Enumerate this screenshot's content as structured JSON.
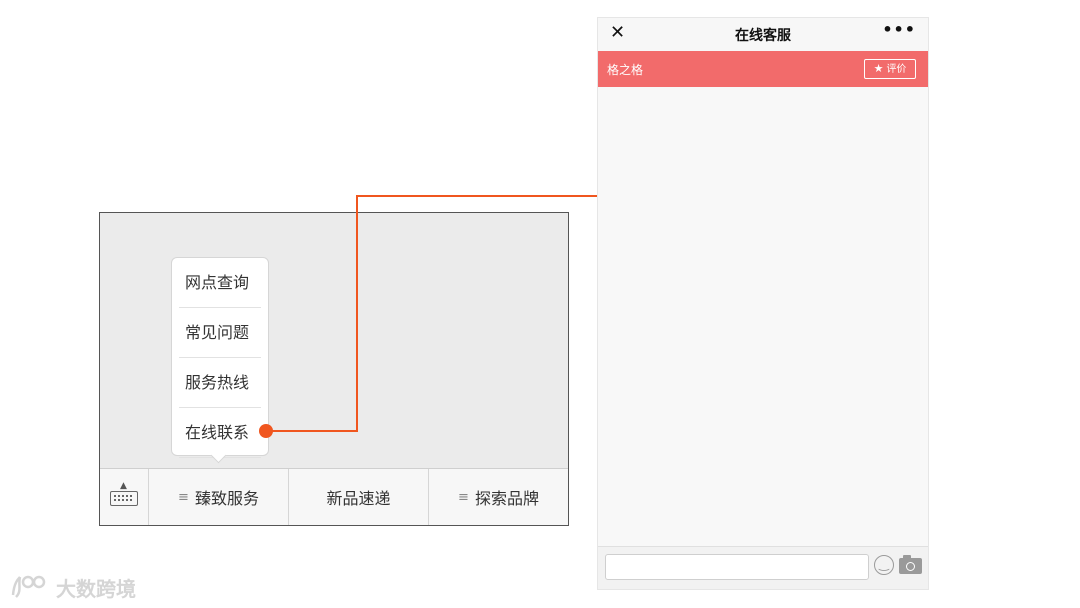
{
  "menu_mockup": {
    "popup_items": [
      "网点查询",
      "常见问题",
      "服务热线",
      "在线联系"
    ],
    "tabs": [
      {
        "label": "臻致服务",
        "has_submenu": true
      },
      {
        "label": "新品速递",
        "has_submenu": false
      },
      {
        "label": "探索品牌",
        "has_submenu": true
      }
    ],
    "submenu_icon": "≡",
    "keyboard_icon": "keyboard-icon"
  },
  "connector": {
    "color": "#f0561f"
  },
  "phone": {
    "header": {
      "title": "在线客服",
      "close_icon": "✕",
      "more_icon": "•••"
    },
    "store_bar": {
      "name": "格之格",
      "rate_label": "评价",
      "color": "#f26b6b"
    },
    "input": {
      "placeholder": ""
    }
  },
  "watermark": {
    "text": "大数跨境"
  }
}
